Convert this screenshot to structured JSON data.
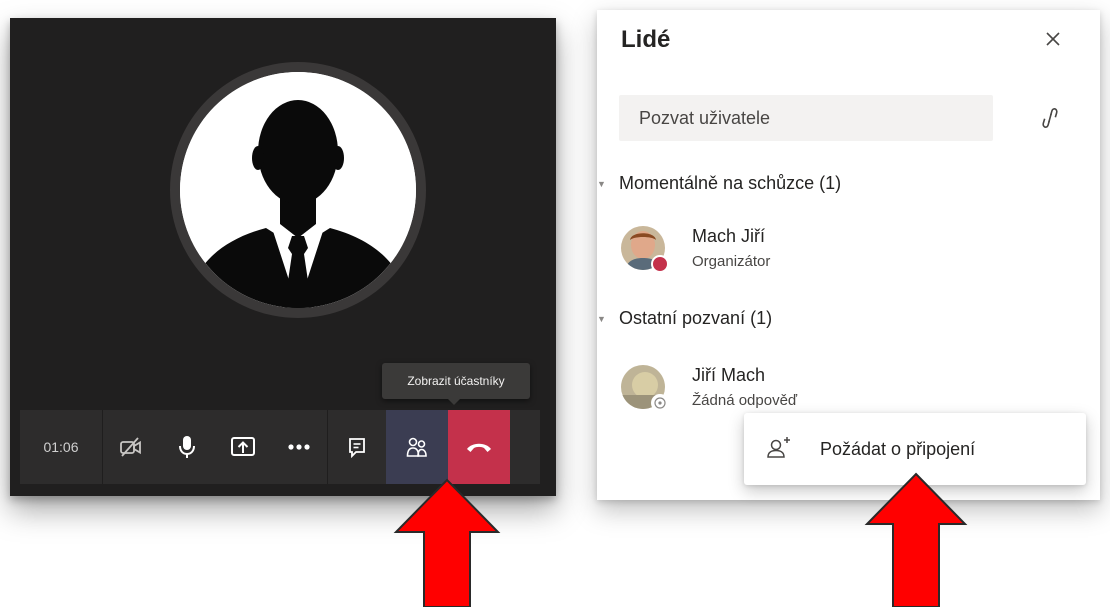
{
  "call": {
    "timer": "01:06",
    "tooltip": "Zobrazit účastníky",
    "controls": [
      {
        "icon": "video-off-icon"
      },
      {
        "icon": "microphone-icon"
      },
      {
        "icon": "share-screen-icon"
      },
      {
        "icon": "more-icon"
      },
      {
        "icon": "chat-icon"
      },
      {
        "icon": "participants-icon",
        "active": true
      },
      {
        "icon": "hang-up-icon"
      }
    ]
  },
  "people_panel": {
    "title": "Lidé",
    "invite_placeholder": "Pozvat uživatele",
    "sections": [
      {
        "label": "Momentálně na schůzce (1)",
        "members": [
          {
            "name": "Mach Jiří",
            "role": "Organizátor",
            "status": "busy",
            "status_color": "#c4314b"
          }
        ]
      },
      {
        "label": "Ostatní pozvaní (1)",
        "members": [
          {
            "name": "Jiří Mach",
            "role": "Žádná odpověď",
            "status": "unknown"
          }
        ]
      }
    ],
    "context_menu": {
      "item_label": "Požádat o připojení",
      "icon": "add-person-icon"
    }
  },
  "colors": {
    "accent": "#6264a7",
    "hangup": "#c4314b",
    "annotation_arrow": "#ff0000"
  }
}
